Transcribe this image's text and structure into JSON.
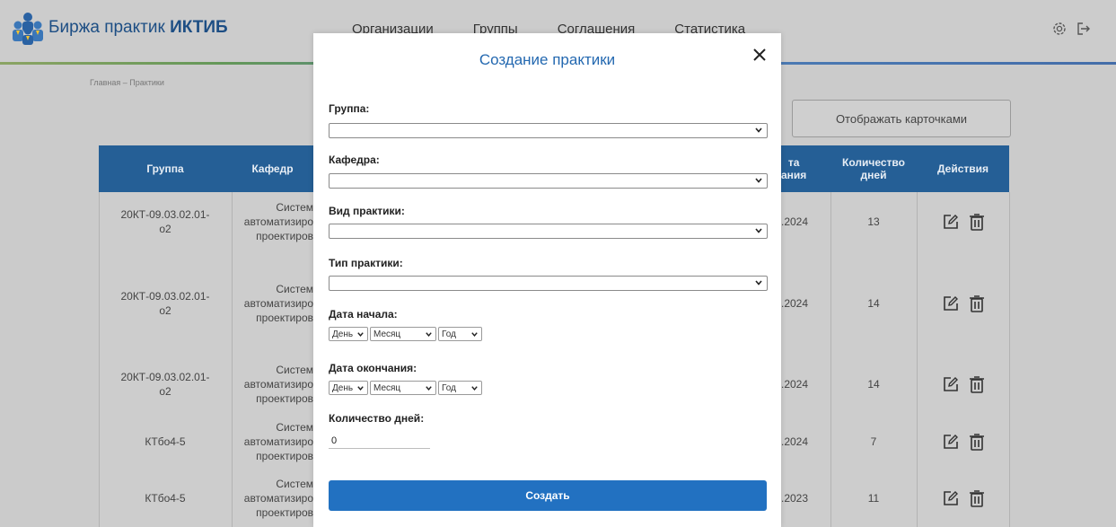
{
  "header": {
    "logo_text_regular": "Биржа практик ",
    "logo_text_bold": "ИКТИБ",
    "nav": [
      "Организации",
      "Группы",
      "Соглашения",
      "Статистика"
    ]
  },
  "breadcrumb": "Главная – Практики",
  "view_toggle_label": "Отображать карточками",
  "table": {
    "headers": {
      "group": "Группа",
      "department": "Кафедр",
      "date_end": "та\nания",
      "days": "Количество\nдней",
      "actions": "Действия"
    },
    "rows": [
      {
        "group": "20КТ-09.03.02.01-\nо2",
        "department": "Систем\nавтоматизиро\nпроектиров",
        "date": ".2024",
        "days": "13"
      },
      {
        "group": "20КТ-09.03.02.01-\nо2",
        "department": "Систем\nавтоматизиро\nпроектиров",
        "date": ".2024",
        "days": "14"
      },
      {
        "group": "20КТ-09.03.02.01-\nо2",
        "department": "Систем\nавтоматизиро\nпроектиров",
        "date": ".2024",
        "days": "14"
      },
      {
        "group": "КТбо4-5",
        "department": "Систем\nавтоматизиро\nпроектиров",
        "date": ".2024",
        "days": "7"
      },
      {
        "group": "КТбо4-5",
        "department": "Систем\nавтоматизиро\nпроектиров",
        "date": ".2023",
        "days": "11"
      }
    ]
  },
  "modal": {
    "title": "Создание практики",
    "fields": {
      "group_label": "Группа:",
      "department_label": "Кафедра:",
      "practice_kind_label": "Вид практики:",
      "practice_type_label": "Тип практики:",
      "start_date_label": "Дата начала:",
      "end_date_label": "Дата окончания:",
      "days_label": "Количество дней:",
      "days_value": "0"
    },
    "date_selects": {
      "day": "День",
      "month": "Месяц",
      "year": "Год"
    },
    "submit_label": "Создать"
  },
  "colors": {
    "brand_blue": "#2271c1",
    "table_header": "#255f96",
    "title_blue": "#2368b0"
  },
  "icons": [
    "logo-people-icon",
    "gear-icon",
    "logout-icon",
    "edit-icon",
    "trash-icon",
    "close-icon",
    "chevron-down-icon"
  ]
}
